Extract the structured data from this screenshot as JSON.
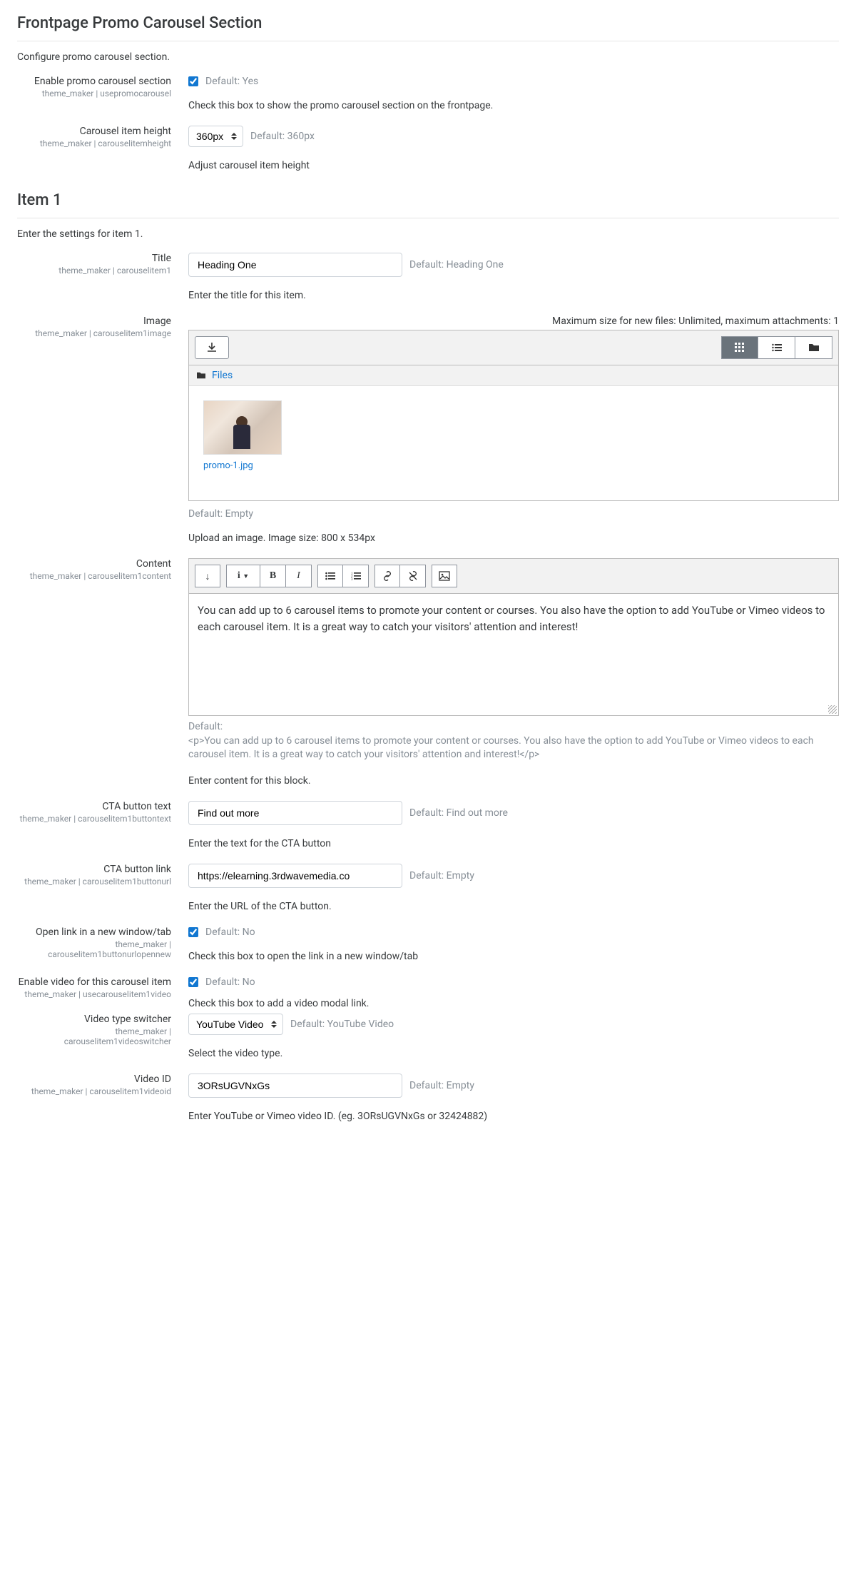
{
  "section": {
    "title": "Frontpage Promo Carousel Section",
    "desc": "Configure promo carousel section."
  },
  "enable": {
    "label": "Enable promo carousel section",
    "sub": "theme_maker | usepromocarousel",
    "checked": true,
    "hint": "Default: Yes",
    "help": "Check this box to show the promo carousel section on the frontpage."
  },
  "height": {
    "label": "Carousel item height",
    "sub": "theme_maker | carouselitemheight",
    "value": "360px",
    "hint": "Default: 360px",
    "help": "Adjust carousel item height"
  },
  "item_hdr": {
    "title": "Item 1",
    "desc": "Enter the settings for item 1."
  },
  "title": {
    "label": "Title",
    "sub": "theme_maker | carouselitem1",
    "value": "Heading One",
    "hint": "Default: Heading One",
    "help": "Enter the title for this item."
  },
  "image": {
    "label": "Image",
    "sub": "theme_maker | carouselitem1image",
    "fileinfo": "Maximum size for new files: Unlimited, maximum attachments: 1",
    "files_link": "Files",
    "thumbname": "promo-1.jpg",
    "hint": "Default: Empty",
    "help": "Upload an image. Image size: 800 x 534px"
  },
  "content": {
    "label": "Content",
    "sub": "theme_maker | carouselitem1content",
    "body": "You can add up to 6 carousel items to promote your content or courses. You also have the option to add YouTube or Vimeo videos to each carousel item. It is a great way to catch your visitors' attention and interest!",
    "default_lbl": "Default:",
    "default_body": "<p>You can add up to 6 carousel items to promote your content or courses. You also have the option to add YouTube or Vimeo videos to each carousel item. It is a great way to catch your visitors' attention and interest!</p>",
    "help": "Enter content for this block."
  },
  "cta_text": {
    "label": "CTA button text",
    "sub": "theme_maker | carouselitem1buttontext",
    "value": "Find out more",
    "hint": "Default: Find out more",
    "help": "Enter the text for the CTA button"
  },
  "cta_link": {
    "label": "CTA button link",
    "sub": "theme_maker | carouselitem1buttonurl",
    "value": "https://elearning.3rdwavemedia.co",
    "hint": "Default: Empty",
    "help": "Enter the URL of the CTA button."
  },
  "openwin": {
    "label": "Open link in a new window/tab",
    "sub": "theme_maker | carouselitem1buttonurlopennew",
    "checked": true,
    "hint": "Default: No",
    "help": "Check this box to open the link in a new window/tab"
  },
  "video_enable": {
    "label": "Enable video for this carousel item",
    "sub": "theme_maker | usecarouselitem1video",
    "checked": true,
    "hint": "Default: No",
    "help": "Check this box to add a video modal link."
  },
  "video_type": {
    "label": "Video type switcher",
    "sub": "theme_maker | carouselitem1videoswitcher",
    "value": "YouTube Video",
    "hint": "Default: YouTube Video",
    "help": "Select the video type."
  },
  "video_id": {
    "label": "Video ID",
    "sub": "theme_maker | carouselitem1videoid",
    "value": "3ORsUGVNxGs",
    "hint": "Default: Empty",
    "help": "Enter YouTube or Vimeo video ID. (eg. 3ORsUGVNxGs or 32424882)"
  }
}
